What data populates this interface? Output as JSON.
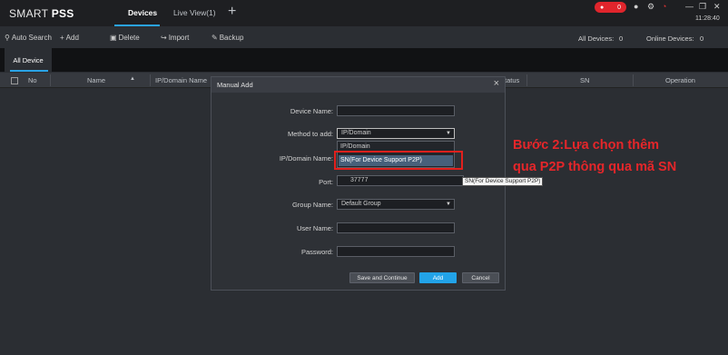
{
  "app": {
    "logo_light": "SMART ",
    "logo_bold": "PSS",
    "clock": "11:28:40"
  },
  "tabs": [
    {
      "label": "Devices"
    },
    {
      "label": "Live View(1)"
    }
  ],
  "alarm": {
    "count": "0"
  },
  "toolbar": {
    "auto_search": "Auto Search",
    "add": "Add",
    "delete": "Delete",
    "import": "Import",
    "backup": "Backup",
    "all_devices_label": "All Devices:",
    "all_devices_count": "0",
    "online_devices_label": "Online Devices:",
    "online_devices_count": "0"
  },
  "subtab": {
    "label": "All Device"
  },
  "table": {
    "headers": [
      "No",
      "Name",
      "IP/Domain Name",
      "tatus",
      "SN",
      "Operation"
    ]
  },
  "modal": {
    "title": "Manual Add",
    "device_name_label": "Device Name:",
    "method_label": "Method to add:",
    "method_value": "IP/Domain",
    "method_options": [
      "IP/Domain",
      "SN(For Device Support P2P)"
    ],
    "ip_label": "IP/Domain Name:",
    "port_label": "Port:",
    "port_value": "37777",
    "group_label": "Group Name:",
    "group_value": "Default Group",
    "user_label": "User Name:",
    "password_label": "Password:",
    "save_continue": "Save and Continue",
    "add": "Add",
    "cancel": "Cancel",
    "required_mark": "*"
  },
  "tooltip": "SN(For Device Support P2P)",
  "annotation": {
    "line1": "Bước 2:Lựa chọn thêm",
    "line2": "qua P2P thông qua mã SN",
    "color": "#e5262a"
  }
}
